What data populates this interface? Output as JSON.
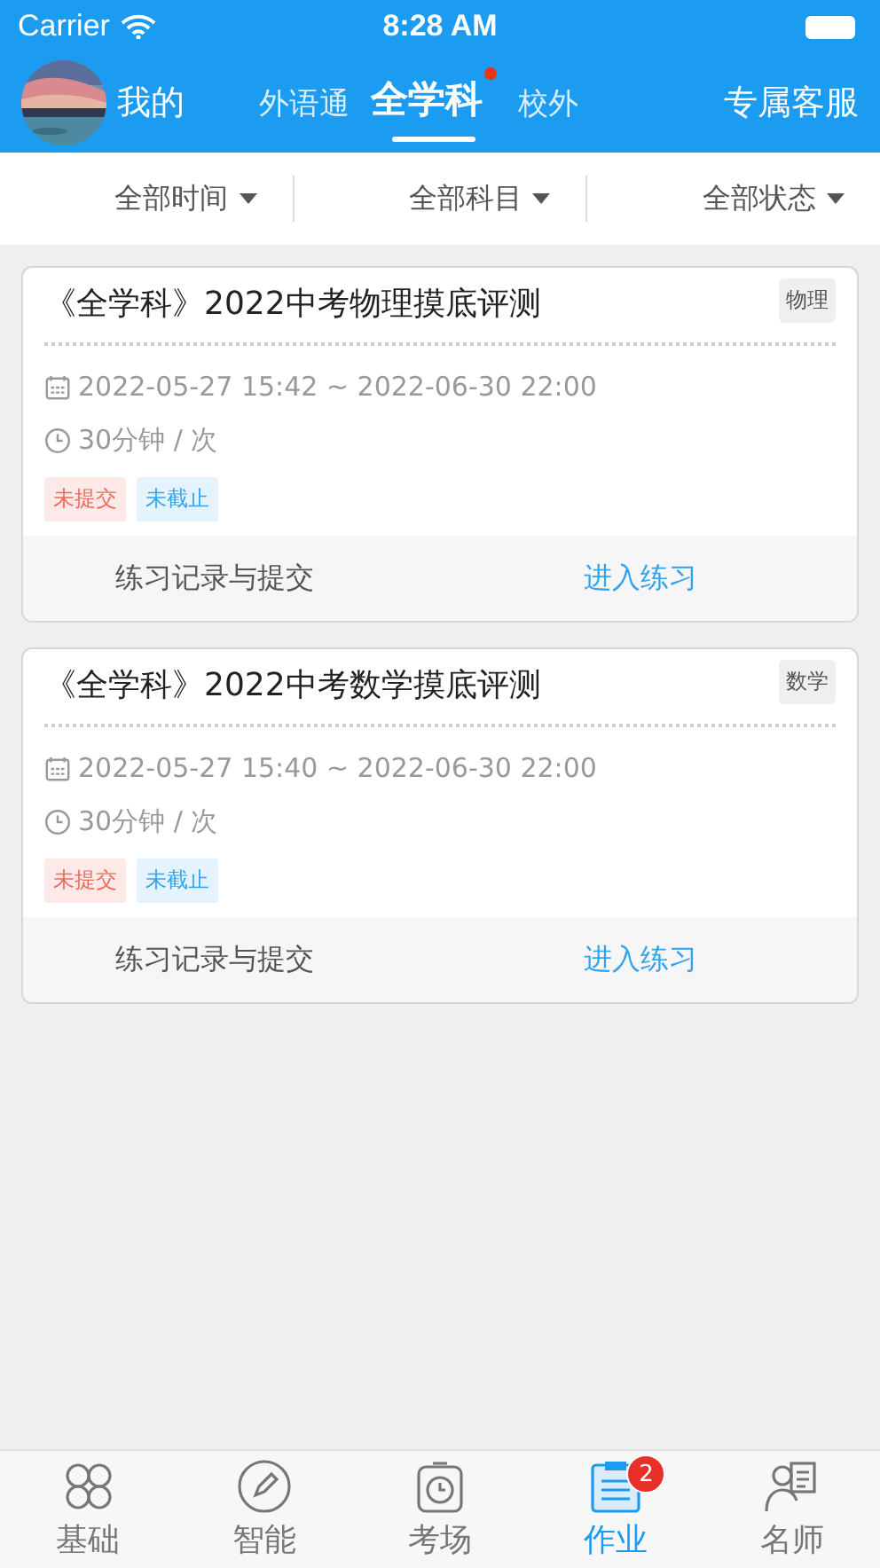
{
  "status_bar": {
    "carrier": "Carrier",
    "time": "8:28 AM"
  },
  "header": {
    "profile_label": "我的",
    "tabs": [
      {
        "label": "外语通",
        "selected": false,
        "dot": false
      },
      {
        "label": "全学科",
        "selected": true,
        "dot": true
      },
      {
        "label": "校外",
        "selected": false,
        "dot": false
      }
    ],
    "service": "专属客服"
  },
  "filters": [
    "全部时间",
    "全部科目",
    "全部状态"
  ],
  "cards": [
    {
      "title": "《全学科》2022中考物理摸底评测",
      "subject": "物理",
      "time_range": "2022-05-27 15:42 ~ 2022-06-30 22:00",
      "duration": "30分钟 / 次",
      "tags": [
        {
          "label": "未提交",
          "kind": "warn"
        },
        {
          "label": "未截止",
          "kind": "info"
        }
      ],
      "record": "练习记录与提交",
      "enter": "进入练习"
    },
    {
      "title": "《全学科》2022中考数学摸底评测",
      "subject": "数学",
      "time_range": "2022-05-27 15:40 ~ 2022-06-30 22:00",
      "duration": "30分钟 / 次",
      "tags": [
        {
          "label": "未提交",
          "kind": "warn"
        },
        {
          "label": "未截止",
          "kind": "info"
        }
      ],
      "record": "练习记录与提交",
      "enter": "进入练习"
    }
  ],
  "tab_bar": [
    {
      "label": "基础",
      "kind": "grid",
      "selected": false
    },
    {
      "label": "智能",
      "kind": "pencil",
      "selected": false
    },
    {
      "label": "考场",
      "kind": "timer",
      "selected": false
    },
    {
      "label": "作业",
      "kind": "list",
      "selected": true,
      "badge": "2"
    },
    {
      "label": "名师",
      "kind": "teacher",
      "selected": false
    }
  ]
}
